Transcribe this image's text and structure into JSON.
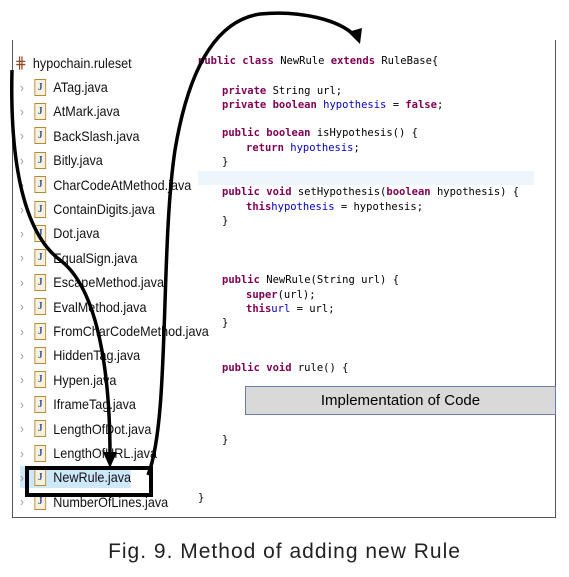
{
  "tree": {
    "root": "hypochain.ruleset",
    "items": [
      "ATag.java",
      "AtMark.java",
      "BackSlash.java",
      "Bitly.java",
      "CharCodeAtMethod.java",
      "ContainDigits.java",
      "Dot.java",
      "EqualSign.java",
      "EscapeMethod.java",
      "EvalMethod.java",
      "FromCharCodeMethod.java",
      "HiddenTag.java",
      "Hypen.java",
      "IframeTag.java",
      "LengthOfDot.java",
      "LengthOfURL.java",
      "NewRule.java",
      "NumberOfLines.java"
    ],
    "selected": "NewRule.java"
  },
  "code": {
    "l1": {
      "a": "public class ",
      "b": "NewRule ",
      "c": "extends ",
      "d": "RuleBase{"
    },
    "l2": {
      "a": "private ",
      "b": "String url;"
    },
    "l3": {
      "a": "private boolean ",
      "b": "hypothesis",
      " c": "",
      "d": " = ",
      "e": "false",
      ";": ";"
    },
    "l4": {
      "a": "public boolean ",
      "b": "isHypothesis() {"
    },
    "l5": {
      "a": "return ",
      "b": "hypothesis",
      ";": ";"
    },
    "l6": "}",
    "l7": {
      "a": "public void ",
      "b": "setHypothesis(",
      "c": "boolean ",
      "d": "hypothesis) {"
    },
    "l8": {
      "a": "this",
      ".": ".",
      "b": "hypothesis",
      " ": " = hypothesis;"
    },
    "l9": "}",
    "l10": {
      "a": "public ",
      "b": "NewRule(String url) {"
    },
    "l11": {
      "a": "super",
      "b": "(url);"
    },
    "l12": {
      "a": "this",
      ".": ".",
      "b": "url",
      " ": " = url;"
    },
    "l13": "}",
    "l14": {
      "a": "public void ",
      "b": "rule() {"
    },
    "l15": "}",
    "l16": "}"
  },
  "implementation_label": "Implementation of Code",
  "caption": "Fig. 9. Method of adding new Rule"
}
